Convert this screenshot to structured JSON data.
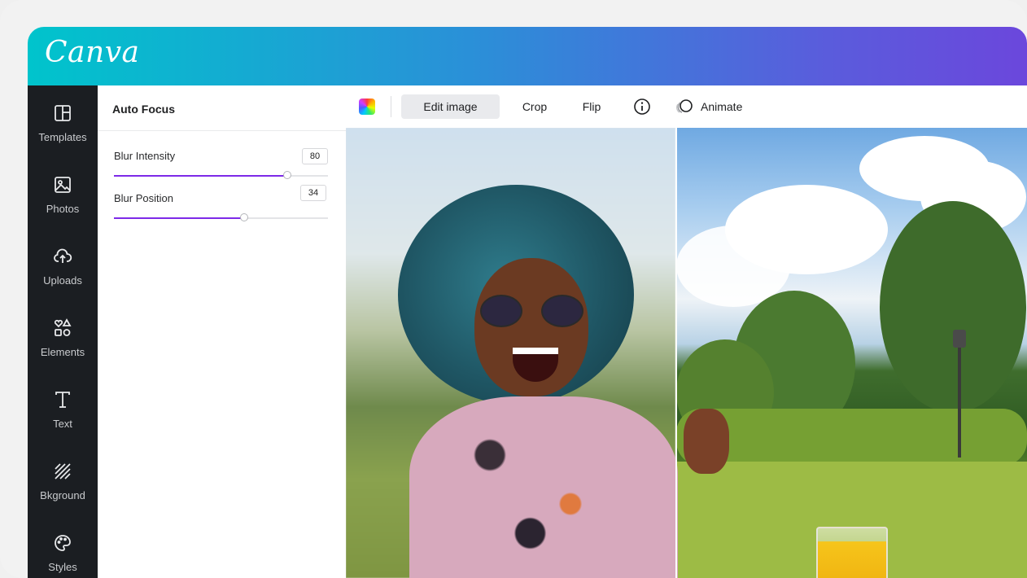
{
  "app": {
    "logo_text": "Canva"
  },
  "sidebar": {
    "items": [
      {
        "label": "Templates",
        "icon": "templates-icon"
      },
      {
        "label": "Photos",
        "icon": "photos-icon"
      },
      {
        "label": "Uploads",
        "icon": "upload-icon"
      },
      {
        "label": "Elements",
        "icon": "elements-icon"
      },
      {
        "label": "Text",
        "icon": "text-icon"
      },
      {
        "label": "Bkground",
        "icon": "background-icon"
      },
      {
        "label": "Styles",
        "icon": "palette-icon"
      }
    ]
  },
  "panel": {
    "title": "Auto Focus",
    "controls": [
      {
        "label": "Blur Intensity",
        "value": "80",
        "level": 0.81
      },
      {
        "label": "Blur Position",
        "value": "34",
        "level": 0.61
      }
    ]
  },
  "toolbar": {
    "color_swatch": "rainbow",
    "edit_image": "Edit image",
    "crop": "Crop",
    "flip": "Flip",
    "info_icon": "info-icon",
    "animate": "Animate"
  },
  "colors": {
    "accent": "#7d2ae8",
    "sidebar_bg": "#1b1e22",
    "header_gradient_start": "#00c4cc",
    "header_gradient_end": "#6b47dc"
  }
}
